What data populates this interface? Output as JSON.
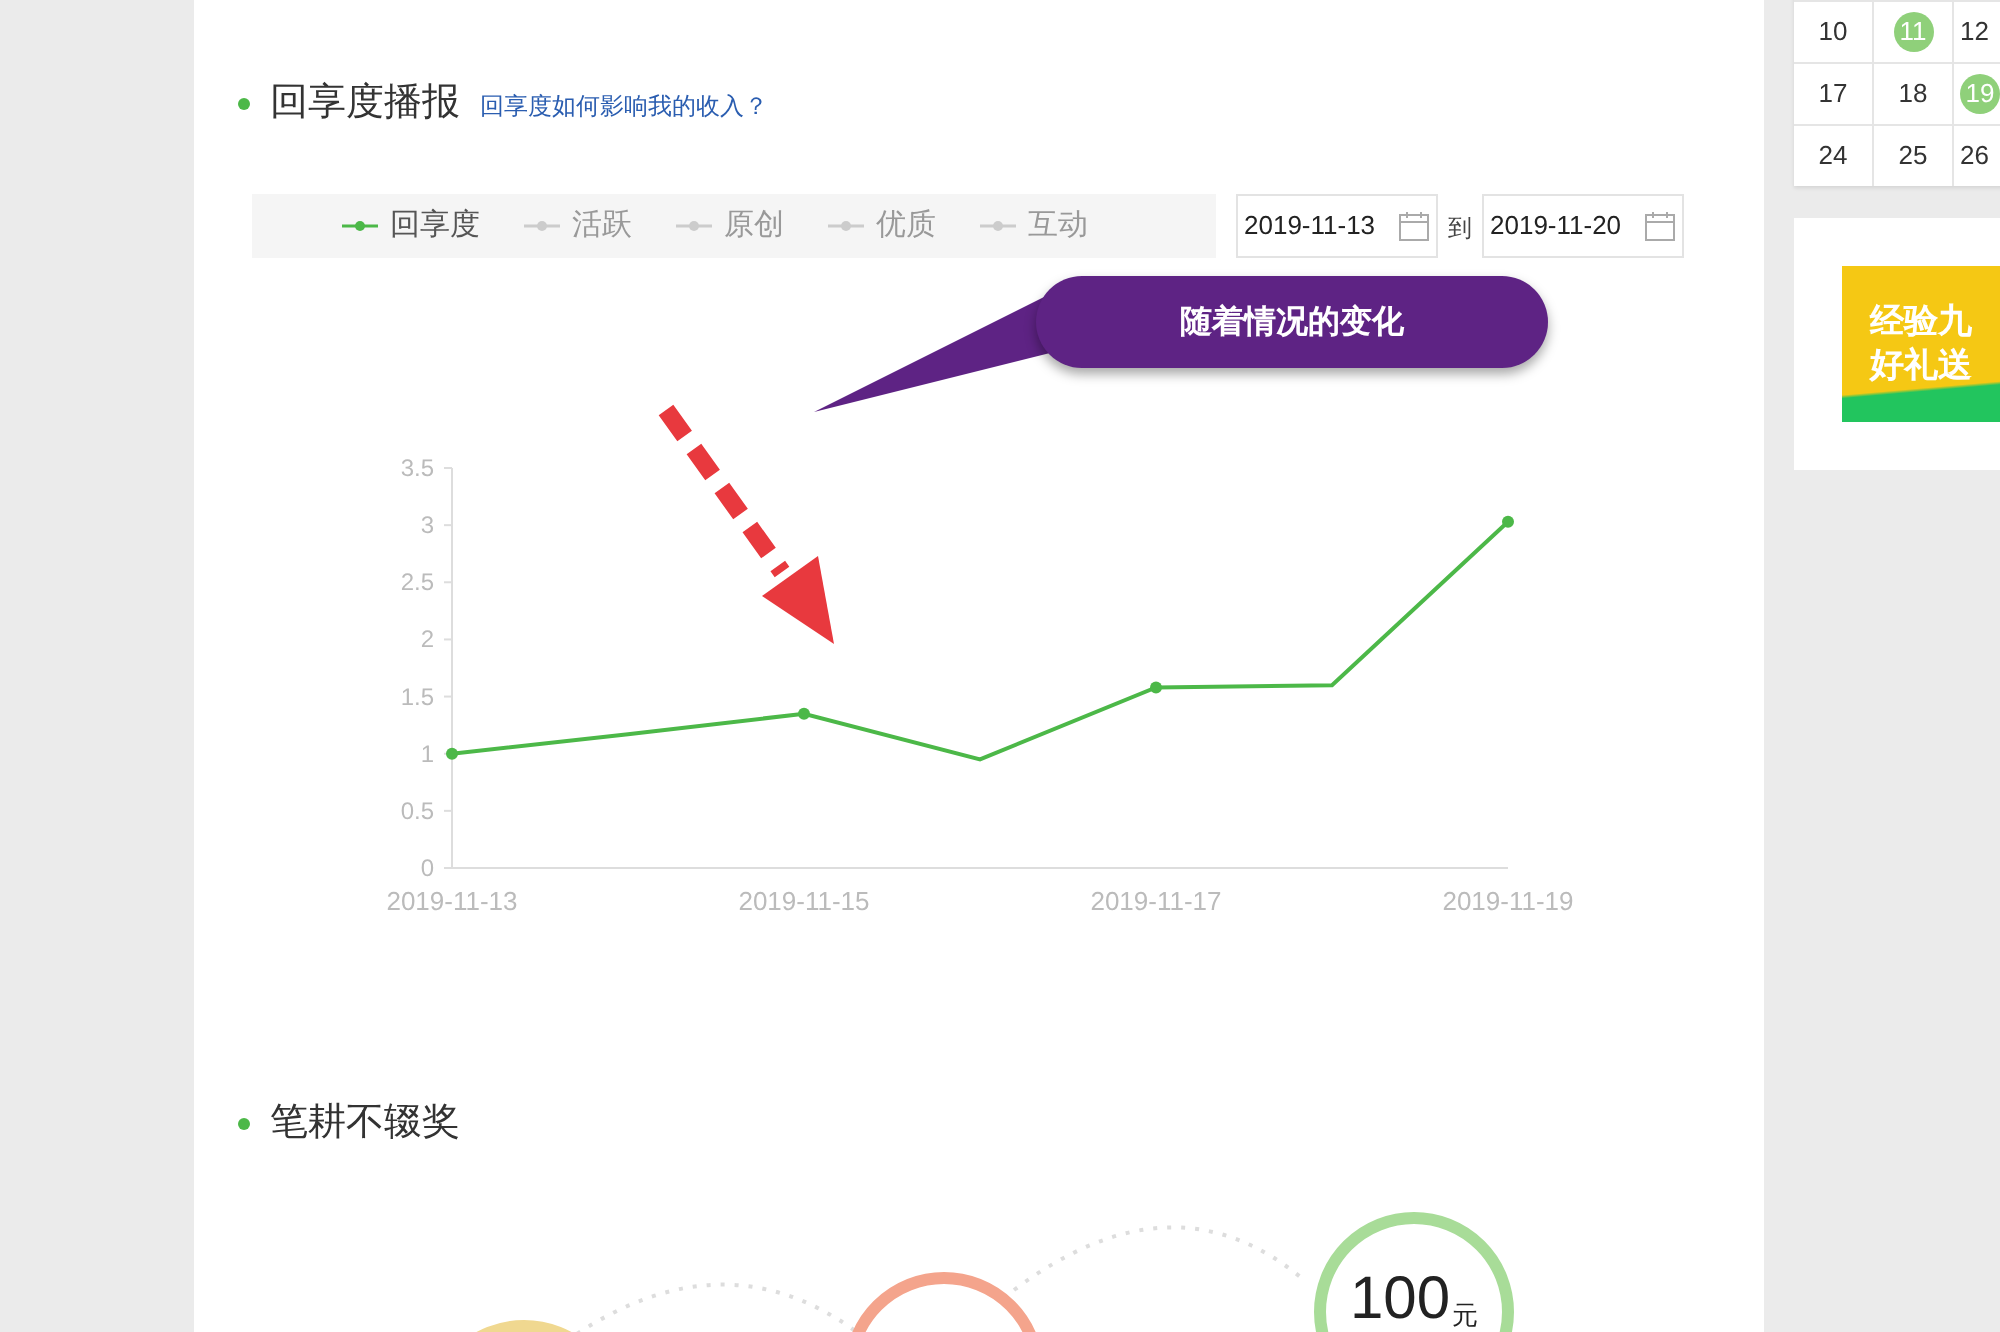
{
  "sections": [
    {
      "title": "回享度播报",
      "help_link": "回享度如何影响我的收入？"
    },
    {
      "title": "笔耕不辍奖"
    }
  ],
  "legend": [
    {
      "label": "回享度",
      "selected": true
    },
    {
      "label": "活跃",
      "selected": false
    },
    {
      "label": "原创",
      "selected": false
    },
    {
      "label": "优质",
      "selected": false
    },
    {
      "label": "互动",
      "selected": false
    }
  ],
  "date_range": {
    "start": "2019-11-13",
    "separator": "到",
    "end": "2019-11-20"
  },
  "callout": "随着情况的变化",
  "chart_data": {
    "type": "line",
    "categories": [
      "2019-11-13",
      null,
      "2019-11-15",
      null,
      "2019-11-17",
      null,
      "2019-11-19"
    ],
    "series": [
      {
        "color": "#4cb848",
        "values": [
          1.0,
          1.17,
          1.35,
          0.95,
          1.58,
          1.6,
          3.03
        ]
      }
    ],
    "ylim": [
      0,
      3.5
    ],
    "yticks": [
      0,
      0.5,
      1,
      1.5,
      2,
      2.5,
      3,
      3.5
    ]
  },
  "rewards": [
    {
      "color": "#f0d890"
    },
    {
      "color": "#f4a48c"
    },
    {
      "color": "#a8dc98",
      "amount": "100",
      "unit": "元"
    }
  ],
  "calendar": {
    "rows": [
      [
        {
          "day": "10",
          "selected": false
        },
        {
          "day": "11",
          "selected": true
        },
        {
          "day": "12",
          "selected": false
        }
      ],
      [
        {
          "day": "17",
          "selected": false
        },
        {
          "day": "18",
          "selected": false
        },
        {
          "day": "19",
          "selected": true
        }
      ],
      [
        {
          "day": "24",
          "selected": false
        },
        {
          "day": "25",
          "selected": false
        },
        {
          "day": "26",
          "selected": false
        }
      ]
    ]
  },
  "banner": {
    "lines": [
      "经验九",
      "好礼送"
    ]
  }
}
